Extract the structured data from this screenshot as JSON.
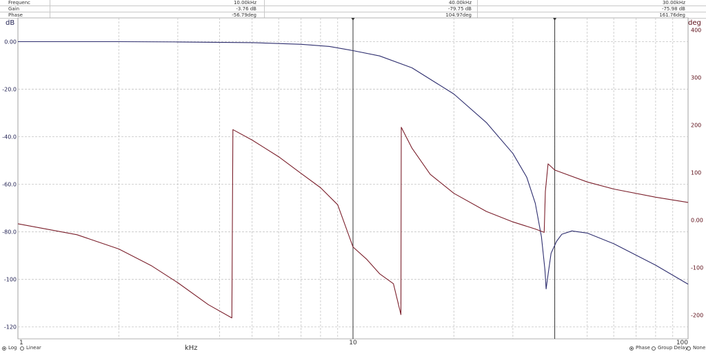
{
  "readout": {
    "rows": [
      {
        "label": "Frequenc",
        "values": [
          "10.00kHz",
          "40.00kHz",
          "30.00kHz"
        ]
      },
      {
        "label": "Gain",
        "values": [
          "-3.76 dB",
          "-79.75 dB",
          "-75.98 dB"
        ]
      },
      {
        "label": "Phase",
        "values": [
          "-56.79deg",
          "104.97deg",
          "161.76deg"
        ]
      }
    ]
  },
  "axis_units": {
    "left": "dB",
    "right": "deg"
  },
  "bottom": {
    "xlabel": "kHz",
    "scale_options": [
      {
        "label": "Log",
        "selected": true
      },
      {
        "label": "Linear",
        "selected": false
      }
    ],
    "plot_options": [
      {
        "label": "Phase",
        "selected": true
      },
      {
        "label": "Group Delay",
        "selected": false
      },
      {
        "label": "None",
        "selected": false
      }
    ]
  },
  "chart_data": {
    "type": "line",
    "title": "",
    "xlabel": "kHz",
    "ylabel": "dB",
    "y2label": "deg",
    "xscale": "log",
    "xlim": [
      1,
      100
    ],
    "ylim": [
      -125,
      10
    ],
    "y2lim": [
      -250,
      425
    ],
    "x_ticks": [
      1,
      10,
      100
    ],
    "x_tick_labels": [
      "1",
      "10",
      "100"
    ],
    "y_ticks": [
      0,
      -20,
      -40,
      -60,
      -80,
      -100,
      -120
    ],
    "y_tick_labels": [
      "0.00",
      "-20.0",
      "-40.0",
      "-60.0",
      "-80.0",
      "-100",
      "-120"
    ],
    "y2_ticks": [
      400,
      300,
      200,
      100,
      0,
      -100,
      -200
    ],
    "y2_tick_labels": [
      "400",
      "300",
      "200",
      "100",
      "0.00",
      "-100",
      "-200"
    ],
    "grid": true,
    "cursors_khz": [
      10,
      40
    ],
    "colors": {
      "gain": "#2d2d6e",
      "phase": "#7a1e2a",
      "left_axis": "#1e1e50",
      "right_axis": "#5a0a14",
      "grid": "#c4c4c4"
    },
    "series": [
      {
        "axis": "left",
        "points": [
          [
            1,
            0
          ],
          [
            2,
            0
          ],
          [
            3,
            -0.1
          ],
          [
            5,
            -0.4
          ],
          [
            7,
            -1.1
          ],
          [
            8.5,
            -2.0
          ],
          [
            10,
            -3.76
          ],
          [
            12,
            -6
          ],
          [
            15,
            -11
          ],
          [
            20,
            -22
          ],
          [
            25,
            -34
          ],
          [
            30,
            -47
          ],
          [
            33,
            -57
          ],
          [
            35,
            -68
          ],
          [
            36.5,
            -82
          ],
          [
            37.4,
            -96
          ],
          [
            37.7,
            -104
          ],
          [
            38.2,
            -98
          ],
          [
            39,
            -89
          ],
          [
            40.5,
            -84
          ],
          [
            42,
            -81
          ],
          [
            45,
            -79.6
          ],
          [
            50,
            -80.5
          ],
          [
            60,
            -85
          ],
          [
            80,
            -94
          ],
          [
            100,
            -102
          ]
        ]
      },
      {
        "axis": "right",
        "points": [
          [
            1,
            -8
          ],
          [
            1.5,
            -31
          ],
          [
            2,
            -61
          ],
          [
            2.5,
            -96
          ],
          [
            3,
            -132
          ],
          [
            3.7,
            -178
          ],
          [
            4.35,
            -206
          ],
          [
            4.38,
            190
          ],
          [
            5,
            168
          ],
          [
            6,
            133
          ],
          [
            7,
            98
          ],
          [
            8,
            68
          ],
          [
            9,
            32
          ],
          [
            10,
            -56.79
          ],
          [
            11,
            -83
          ],
          [
            12,
            -113
          ],
          [
            13.2,
            -134
          ],
          [
            13.9,
            -199
          ],
          [
            13.93,
            195
          ],
          [
            15,
            151
          ],
          [
            17,
            96
          ],
          [
            20,
            56
          ],
          [
            25,
            18
          ],
          [
            30,
            -4
          ],
          [
            35,
            -19
          ],
          [
            37.2,
            -26
          ],
          [
            37.5,
            60
          ],
          [
            38.2,
            118
          ],
          [
            40,
            104.97
          ],
          [
            50,
            80
          ],
          [
            60,
            65
          ],
          [
            80,
            48
          ],
          [
            100,
            37
          ]
        ]
      }
    ]
  }
}
